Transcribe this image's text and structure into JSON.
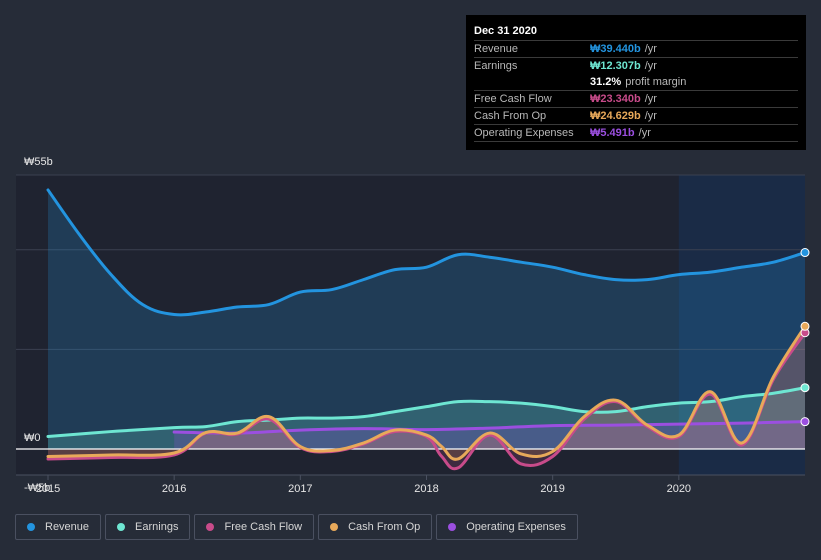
{
  "tooltip": {
    "date": "Dec 31 2020",
    "rows": [
      {
        "label": "Revenue",
        "value": "₩39.440b",
        "unit": "/yr",
        "color": "#2394df"
      },
      {
        "label": "Earnings",
        "value": "₩12.307b",
        "unit": "/yr",
        "color": "#6ee6d2"
      },
      {
        "label": "",
        "value": "31.2%",
        "unit": "profit margin",
        "color": "#ffffff"
      },
      {
        "label": "Free Cash Flow",
        "value": "₩23.340b",
        "unit": "/yr",
        "color": "#c84b8a"
      },
      {
        "label": "Cash From Op",
        "value": "₩24.629b",
        "unit": "/yr",
        "color": "#e8a95a"
      },
      {
        "label": "Operating Expenses",
        "value": "₩5.491b",
        "unit": "/yr",
        "color": "#9b4fe0"
      }
    ]
  },
  "legend": [
    {
      "label": "Revenue",
      "color": "#2394df"
    },
    {
      "label": "Earnings",
      "color": "#6ee6d2"
    },
    {
      "label": "Free Cash Flow",
      "color": "#c84b8a"
    },
    {
      "label": "Cash From Op",
      "color": "#e8a95a"
    },
    {
      "label": "Operating Expenses",
      "color": "#9b4fe0"
    }
  ],
  "chart_data": {
    "type": "area",
    "title": "",
    "xlabel": "",
    "ylabel": "",
    "currency": "₩",
    "ylim": [
      -5,
      55
    ],
    "xlim": [
      2015,
      2021
    ],
    "y_tick_labels": [
      "₩55b",
      "₩0",
      "-₩5b"
    ],
    "x_tick_labels": [
      "2015",
      "2016",
      "2017",
      "2018",
      "2019",
      "2020"
    ],
    "grid": true,
    "legend_position": "bottom",
    "highlight_from": 2020,
    "series": [
      {
        "name": "Revenue",
        "color": "#2394df",
        "x": [
          2015,
          2015.25,
          2015.5,
          2015.75,
          2016,
          2016.25,
          2016.5,
          2016.75,
          2017,
          2017.25,
          2017.5,
          2017.75,
          2018,
          2018.25,
          2018.5,
          2018.75,
          2019,
          2019.25,
          2019.5,
          2019.75,
          2020,
          2020.25,
          2020.5,
          2020.75,
          2021
        ],
        "y": [
          52,
          43,
          35,
          29,
          27,
          27.5,
          28.5,
          29,
          31.5,
          32,
          34,
          36,
          36.5,
          39,
          38.5,
          37.5,
          36.5,
          35,
          34,
          34,
          35,
          35.5,
          36.5,
          37.5,
          39.44
        ]
      },
      {
        "name": "Earnings",
        "color": "#6ee6d2",
        "x": [
          2015,
          2015.5,
          2016,
          2016.25,
          2016.5,
          2016.75,
          2017,
          2017.25,
          2017.5,
          2017.75,
          2018,
          2018.25,
          2018.5,
          2018.75,
          2019,
          2019.25,
          2019.5,
          2019.75,
          2020,
          2020.25,
          2020.5,
          2020.75,
          2021
        ],
        "y": [
          2.5,
          3.5,
          4.3,
          4.5,
          5.5,
          5.8,
          6.2,
          6.2,
          6.5,
          7.5,
          8.5,
          9.5,
          9.5,
          9.2,
          8.5,
          7.5,
          7.5,
          8.5,
          9.2,
          9.5,
          10.5,
          11.2,
          12.307
        ]
      },
      {
        "name": "Free Cash Flow",
        "color": "#c84b8a",
        "x": [
          2015,
          2015.5,
          2016,
          2016.25,
          2016.5,
          2016.75,
          2017,
          2017.25,
          2017.5,
          2017.75,
          2018,
          2018.12,
          2018.25,
          2018.5,
          2018.75,
          2019,
          2019.25,
          2019.5,
          2019.75,
          2020,
          2020.25,
          2020.5,
          2020.75,
          2021
        ],
        "y": [
          -2.0,
          -1.7,
          -1.2,
          3.2,
          3.0,
          6.0,
          0.3,
          -0.5,
          1.0,
          3.5,
          2.5,
          -1.5,
          -3.8,
          2.8,
          -3.0,
          -1.5,
          6.0,
          9.5,
          4.5,
          2.5,
          11.0,
          0.8,
          14.0,
          23.34
        ]
      },
      {
        "name": "Cash From Op",
        "color": "#e8a95a",
        "x": [
          2015,
          2015.5,
          2016,
          2016.25,
          2016.5,
          2016.75,
          2017,
          2017.25,
          2017.5,
          2017.75,
          2018,
          2018.12,
          2018.25,
          2018.5,
          2018.75,
          2019,
          2019.25,
          2019.5,
          2019.75,
          2020,
          2020.25,
          2020.5,
          2020.75,
          2021
        ],
        "y": [
          -1.5,
          -1.2,
          -0.8,
          3.3,
          3.2,
          6.5,
          0.5,
          -0.3,
          1.2,
          3.8,
          2.8,
          0.5,
          -2.0,
          3.2,
          -1.0,
          -0.5,
          6.5,
          9.8,
          4.8,
          2.8,
          11.5,
          1.2,
          14.5,
          24.629
        ]
      },
      {
        "name": "Operating Expenses",
        "color": "#9b4fe0",
        "x": [
          2016,
          2016.5,
          2017,
          2017.5,
          2018,
          2018.5,
          2019,
          2019.5,
          2020,
          2020.5,
          2021
        ],
        "y": [
          3.4,
          3.2,
          3.8,
          4.1,
          3.9,
          4.2,
          4.7,
          4.8,
          5.0,
          5.2,
          5.491
        ]
      }
    ]
  }
}
